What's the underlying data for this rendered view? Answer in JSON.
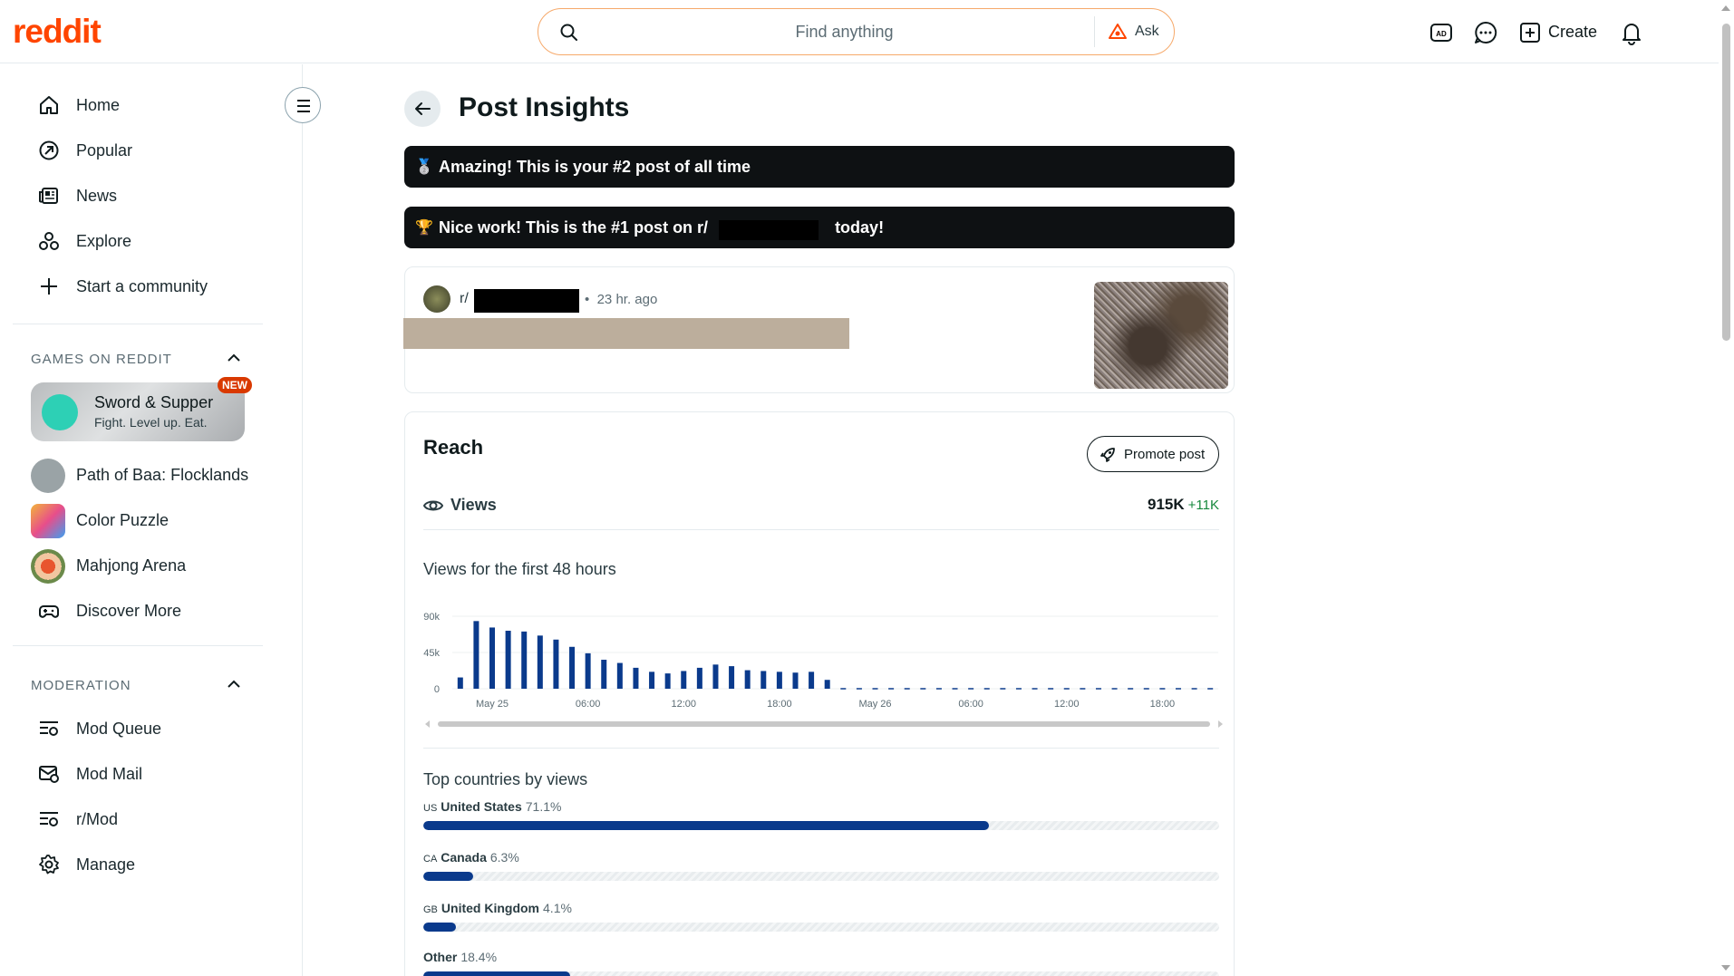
{
  "header": {
    "logo": "reddit",
    "search_placeholder": "Find anything",
    "ask_label": "Ask",
    "create_label": "Create",
    "icons": [
      "ad-icon",
      "chat-icon",
      "create-icon",
      "bell-icon"
    ]
  },
  "sidebar": {
    "nav": [
      {
        "label": "Home",
        "icon": "home-icon"
      },
      {
        "label": "Popular",
        "icon": "popular-icon"
      },
      {
        "label": "News",
        "icon": "news-icon"
      },
      {
        "label": "Explore",
        "icon": "explore-icon"
      },
      {
        "label": "Start a community",
        "icon": "plus-icon"
      }
    ],
    "games_heading": "GAMES ON REDDIT",
    "featured_game": {
      "title": "Sword & Supper",
      "subtitle": "Fight. Level up. Eat.",
      "badge": "NEW"
    },
    "games": [
      {
        "label": "Path of Baa: Flocklands",
        "color": "#9aa3a6"
      },
      {
        "label": "Color Puzzle",
        "color": "#f2b53a"
      },
      {
        "label": "Mahjong Arena",
        "color": "#c96a3c"
      },
      {
        "label": "Discover More",
        "icon": "gamepad-icon"
      }
    ],
    "moderation_heading": "MODERATION",
    "moderation": [
      {
        "label": "Mod Queue",
        "icon": "mod-queue-icon"
      },
      {
        "label": "Mod Mail",
        "icon": "mod-mail-icon"
      },
      {
        "label": "r/Mod",
        "icon": "mod-queue-icon"
      },
      {
        "label": "Manage",
        "icon": "gear-icon"
      }
    ]
  },
  "main": {
    "title": "Post Insights",
    "banner1": "Amazing! This is your #2 post of all time",
    "banner2_prefix": "Nice work! This is the #1 post on r/",
    "banner2_suffix": "today!",
    "post": {
      "subreddit_prefix": "r/",
      "time": "23 hr. ago"
    },
    "reach": {
      "title": "Reach",
      "promote_label": "Promote post",
      "views_label": "Views",
      "views_value": "915K",
      "views_delta": "+11K",
      "chart_title": "Views for the first 48 hours",
      "countries_title": "Top countries by views",
      "countries": [
        {
          "code": "US",
          "name": "United States",
          "pct_label": "71.1%",
          "pct": 71.1
        },
        {
          "code": "CA",
          "name": "Canada",
          "pct_label": "6.3%",
          "pct": 6.3
        },
        {
          "code": "GB",
          "name": "United Kingdom",
          "pct_label": "4.1%",
          "pct": 4.1
        },
        {
          "code": "",
          "name": "Other",
          "pct_label": "18.4%",
          "pct": 18.4
        }
      ]
    }
  },
  "chart_data": {
    "type": "bar",
    "title": "Views for the first 48 hours",
    "yticks": [
      "90k",
      "45k",
      "0"
    ],
    "ylim": [
      0,
      90000
    ],
    "xtick_labels": [
      "May 25",
      "06:00",
      "12:00",
      "18:00",
      "May 26",
      "06:00",
      "12:00",
      "18:00"
    ],
    "values": [
      14000,
      84000,
      76000,
      72000,
      71000,
      66000,
      61000,
      52000,
      44000,
      36000,
      32000,
      26000,
      21000,
      19000,
      22000,
      26000,
      30000,
      28000,
      23000,
      22000,
      21000,
      20000,
      21000,
      11000
    ],
    "color": "#0a3a8c"
  }
}
